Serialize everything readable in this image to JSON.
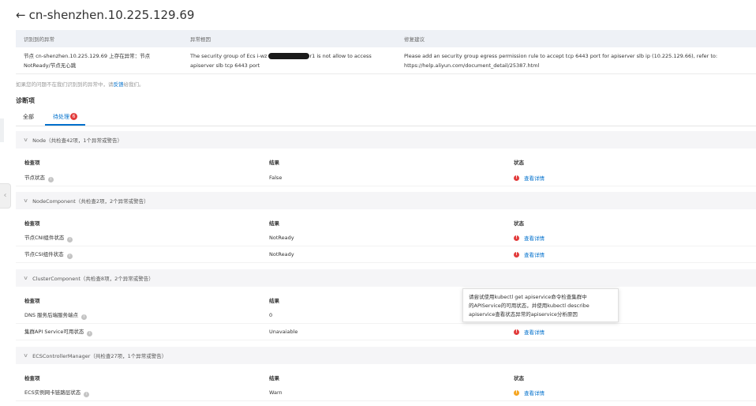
{
  "header": {
    "title": "cn-shenzhen.10.225.129.69"
  },
  "abnormal_table": {
    "columns": [
      "识别到的异常",
      "异常根因",
      "修复建议"
    ],
    "row": {
      "abnormal_1": "节点 cn-shenzhen.10.225.129.69 上存在异常：节点",
      "abnormal_2": "NotReady/节点无心跳",
      "cause_prefix": "The security group of Ecs i-wz",
      "cause_suffix": "r1 is not allow to access",
      "cause_2": "apiserver slb tcp 6443 port",
      "fix_1": "Please add an security group egress permission rule to accept tcp 6443 port for apiserver slb ip (10.225.129.66), refer to:",
      "fix_2": "https://help.aliyun.com/document_detail/25387.html"
    }
  },
  "feedback": {
    "prefix": "如果您的问题不在我们识别到的异常中，请",
    "link": "反馈",
    "suffix": "给我们。"
  },
  "diagnosis": {
    "title": "诊断项",
    "tabs": [
      {
        "label": "全部"
      },
      {
        "label": "待处理",
        "badge": "6"
      }
    ]
  },
  "columns": {
    "item": "检查项",
    "result": "结果",
    "status": "状态"
  },
  "groups": [
    {
      "title": "Node（共检查42项，1个异常或警告）",
      "rows": [
        {
          "item": "节点状态",
          "result": "False",
          "status": "red",
          "link": "查看详情"
        }
      ]
    },
    {
      "title": "NodeComponent（共检查2项，2个异常或警告）",
      "rows": [
        {
          "item": "节点CNI组件状态",
          "result": "NotReady",
          "status": "red",
          "link": "查看详情"
        },
        {
          "item": "节点CSI组件状态",
          "result": "NotReady",
          "status": "red",
          "link": "查看详情"
        }
      ]
    },
    {
      "title": "ClusterComponent（共检查8项，2个异常或警告）",
      "rows": [
        {
          "item": "DNS 服务后端服务端点",
          "result": "0",
          "status": "",
          "link": ""
        },
        {
          "item": "集群API Service可用状态",
          "result": "Unavaiable",
          "status": "red",
          "link": "查看详情"
        }
      ]
    },
    {
      "title": "ECSControllerManager（共检查27项，1个异常或警告）",
      "rows": [
        {
          "item": "ECS实例网卡链路层状态",
          "result": "Warn",
          "status": "orange",
          "link": "查看详情"
        }
      ]
    }
  ],
  "tooltip": {
    "line1": "请尝试使用kubectl get apiservice命令检查集群中",
    "line2": "的APIService的可用状态，并使用kubectl describe",
    "line3": "apiservice查看状态异常的apiservice分析原因"
  },
  "colors": {
    "accent": "#0070cc",
    "error": "#e23c3c",
    "warning": "#f5a623"
  }
}
